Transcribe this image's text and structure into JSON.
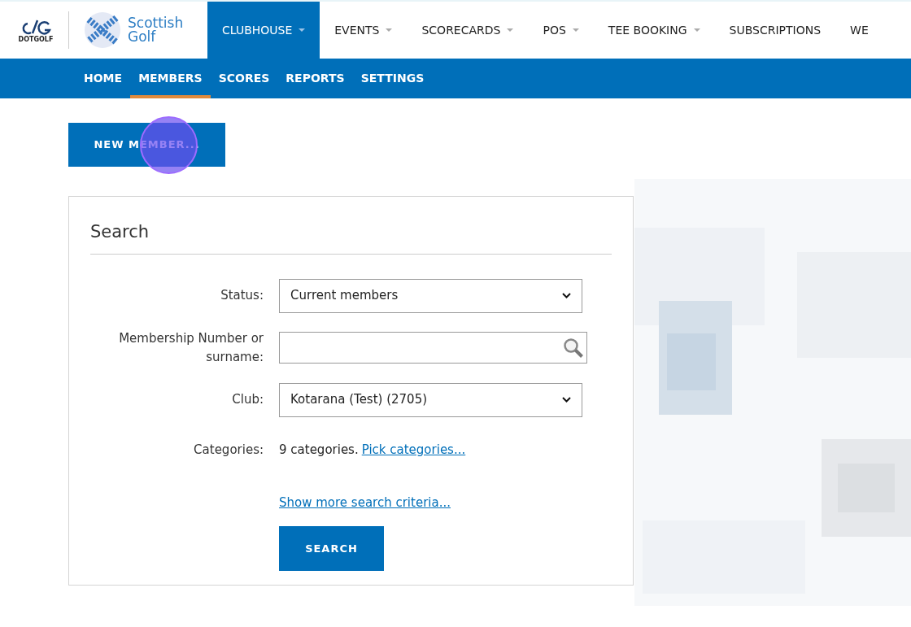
{
  "brand": {
    "dotgolf": "DOTGOLF",
    "logo_text": "Scottish Golf"
  },
  "main_nav": [
    {
      "label": "CLUBHOUSE",
      "selected": true,
      "dropdown": true
    },
    {
      "label": "EVENTS",
      "selected": false,
      "dropdown": true
    },
    {
      "label": "SCORECARDS",
      "selected": false,
      "dropdown": true
    },
    {
      "label": "POS",
      "selected": false,
      "dropdown": true
    },
    {
      "label": "TEE BOOKING",
      "selected": false,
      "dropdown": true
    },
    {
      "label": "SUBSCRIPTIONS",
      "selected": false,
      "dropdown": false
    },
    {
      "label": "WE",
      "selected": false,
      "dropdown": false
    }
  ],
  "sub_nav": [
    {
      "label": "HOME",
      "selected": false
    },
    {
      "label": "MEMBERS",
      "selected": true
    },
    {
      "label": "SCORES",
      "selected": false
    },
    {
      "label": "REPORTS",
      "selected": false
    },
    {
      "label": "SETTINGS",
      "selected": false
    }
  ],
  "new_member_button": "NEW MEMBER...",
  "search": {
    "title": "Search",
    "fields": [
      {
        "kind": "select",
        "label": "Status:",
        "value": "Current members"
      },
      {
        "kind": "search",
        "label": "Membership Number or surname:"
      },
      {
        "kind": "select",
        "label": "Club:",
        "value": "Kotarana (Test) (2705)"
      },
      {
        "kind": "categories",
        "label": "Categories:",
        "value": "9 categories.",
        "link": "Pick categories..."
      }
    ],
    "more_link": "Show more search criteria...",
    "button": "SEARCH"
  }
}
